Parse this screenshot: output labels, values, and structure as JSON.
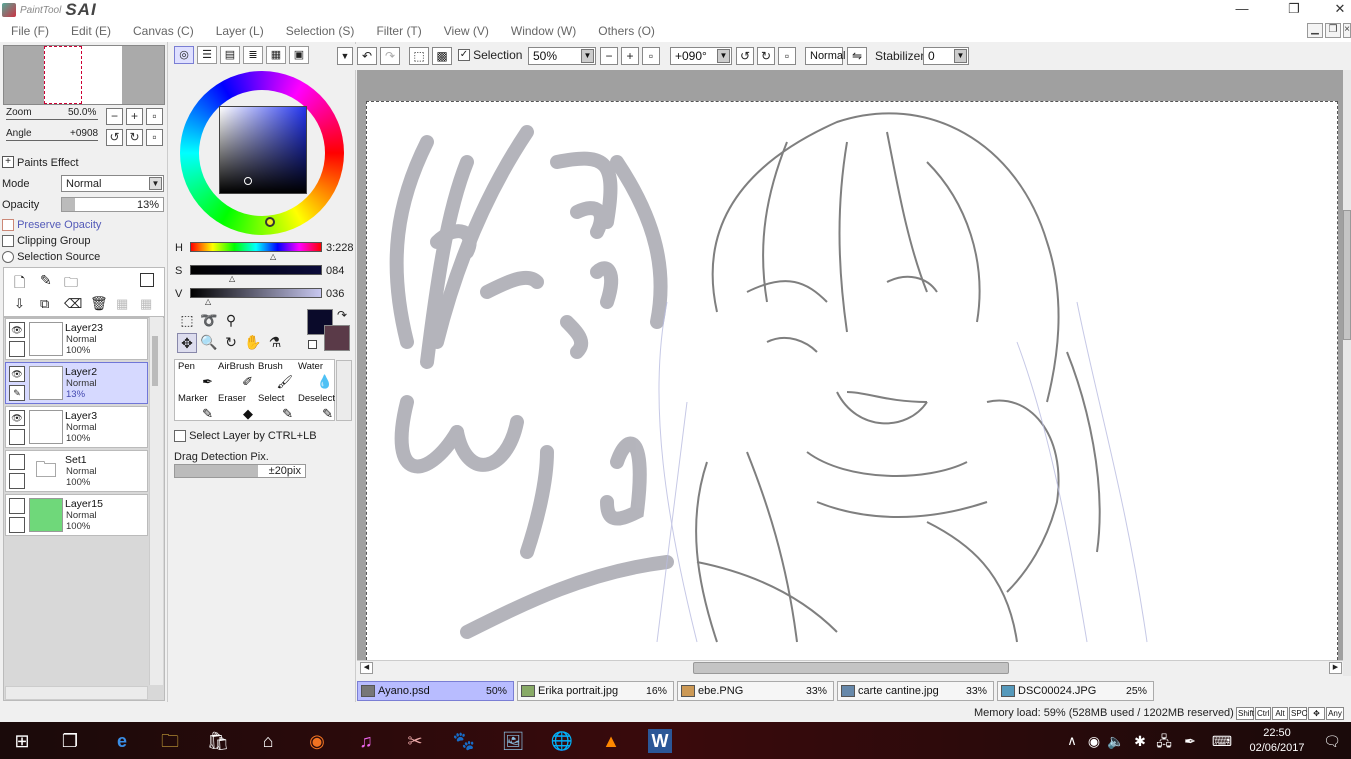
{
  "app": {
    "logo_small": "PaintTool",
    "logo_big": "SAI"
  },
  "window_controls": {
    "minimize": "—",
    "maximize": "❐",
    "close": "✕"
  },
  "menu": [
    "File (F)",
    "Edit (E)",
    "Canvas (C)",
    "Layer (L)",
    "Selection (S)",
    "Filter (T)",
    "View (V)",
    "Window (W)",
    "Others (O)"
  ],
  "navigator": {
    "zoom_label": "Zoom",
    "zoom_value": "50.0%",
    "angle_label": "Angle",
    "angle_value": "+0908"
  },
  "layer_props": {
    "paints_effect": "Paints Effect",
    "mode_label": "Mode",
    "mode_value": "Normal",
    "opacity_label": "Opacity",
    "opacity_value": "13%",
    "opacity_fraction": 0.13,
    "preserve_opacity": "Preserve Opacity",
    "clipping_group": "Clipping Group",
    "selection_source": "Selection Source"
  },
  "layers": [
    {
      "name": "Layer23",
      "mode": "Normal",
      "opacity": "100%",
      "selected": false
    },
    {
      "name": "Layer2",
      "mode": "Normal",
      "opacity": "13%",
      "selected": true
    },
    {
      "name": "Layer3",
      "mode": "Normal",
      "opacity": "100%",
      "selected": false
    },
    {
      "name": "Set1",
      "mode": "Normal",
      "opacity": "100%",
      "selected": false
    },
    {
      "name": "Layer15",
      "mode": "Normal",
      "opacity": "100%",
      "selected": false
    }
  ],
  "color": {
    "h_label": "H",
    "h_value": "3:228",
    "s_label": "S",
    "s_value": "084",
    "v_label": "V",
    "v_value": "036",
    "primary": "#0a0a2a",
    "secondary": "#5a3a48"
  },
  "brushes": [
    "Pen",
    "AirBrush",
    "Brush",
    "Water",
    "Marker",
    "Eraser",
    "Select",
    "Deselect"
  ],
  "tool_options": {
    "select_layer": "Select Layer by CTRL+LB",
    "drag_detection": "Drag Detection Pix.",
    "drag_value": "±20pix"
  },
  "toolbar": {
    "selection_label": "Selection",
    "zoom": "50%",
    "angle": "+090°",
    "blend": "Normal",
    "stabilizer_label": "Stabilizer",
    "stabilizer_value": "0"
  },
  "doc_tabs": [
    {
      "name": "Ayano.psd",
      "zoom": "50%",
      "active": true
    },
    {
      "name": "Erika portrait.jpg",
      "zoom": "16%",
      "active": false
    },
    {
      "name": "ebe.PNG",
      "zoom": "33%",
      "active": false
    },
    {
      "name": "carte cantine.jpg",
      "zoom": "33%",
      "active": false
    },
    {
      "name": "DSC00024.JPG",
      "zoom": "25%",
      "active": false
    }
  ],
  "status": {
    "memory": "Memory load: 59% (528MB used / 1202MB reserved)",
    "keys": [
      "Shift",
      "Ctrl",
      "Alt",
      "SPC",
      "✥",
      "Any"
    ]
  },
  "taskbar": {
    "time": "22:50",
    "date": "02/06/2017"
  }
}
